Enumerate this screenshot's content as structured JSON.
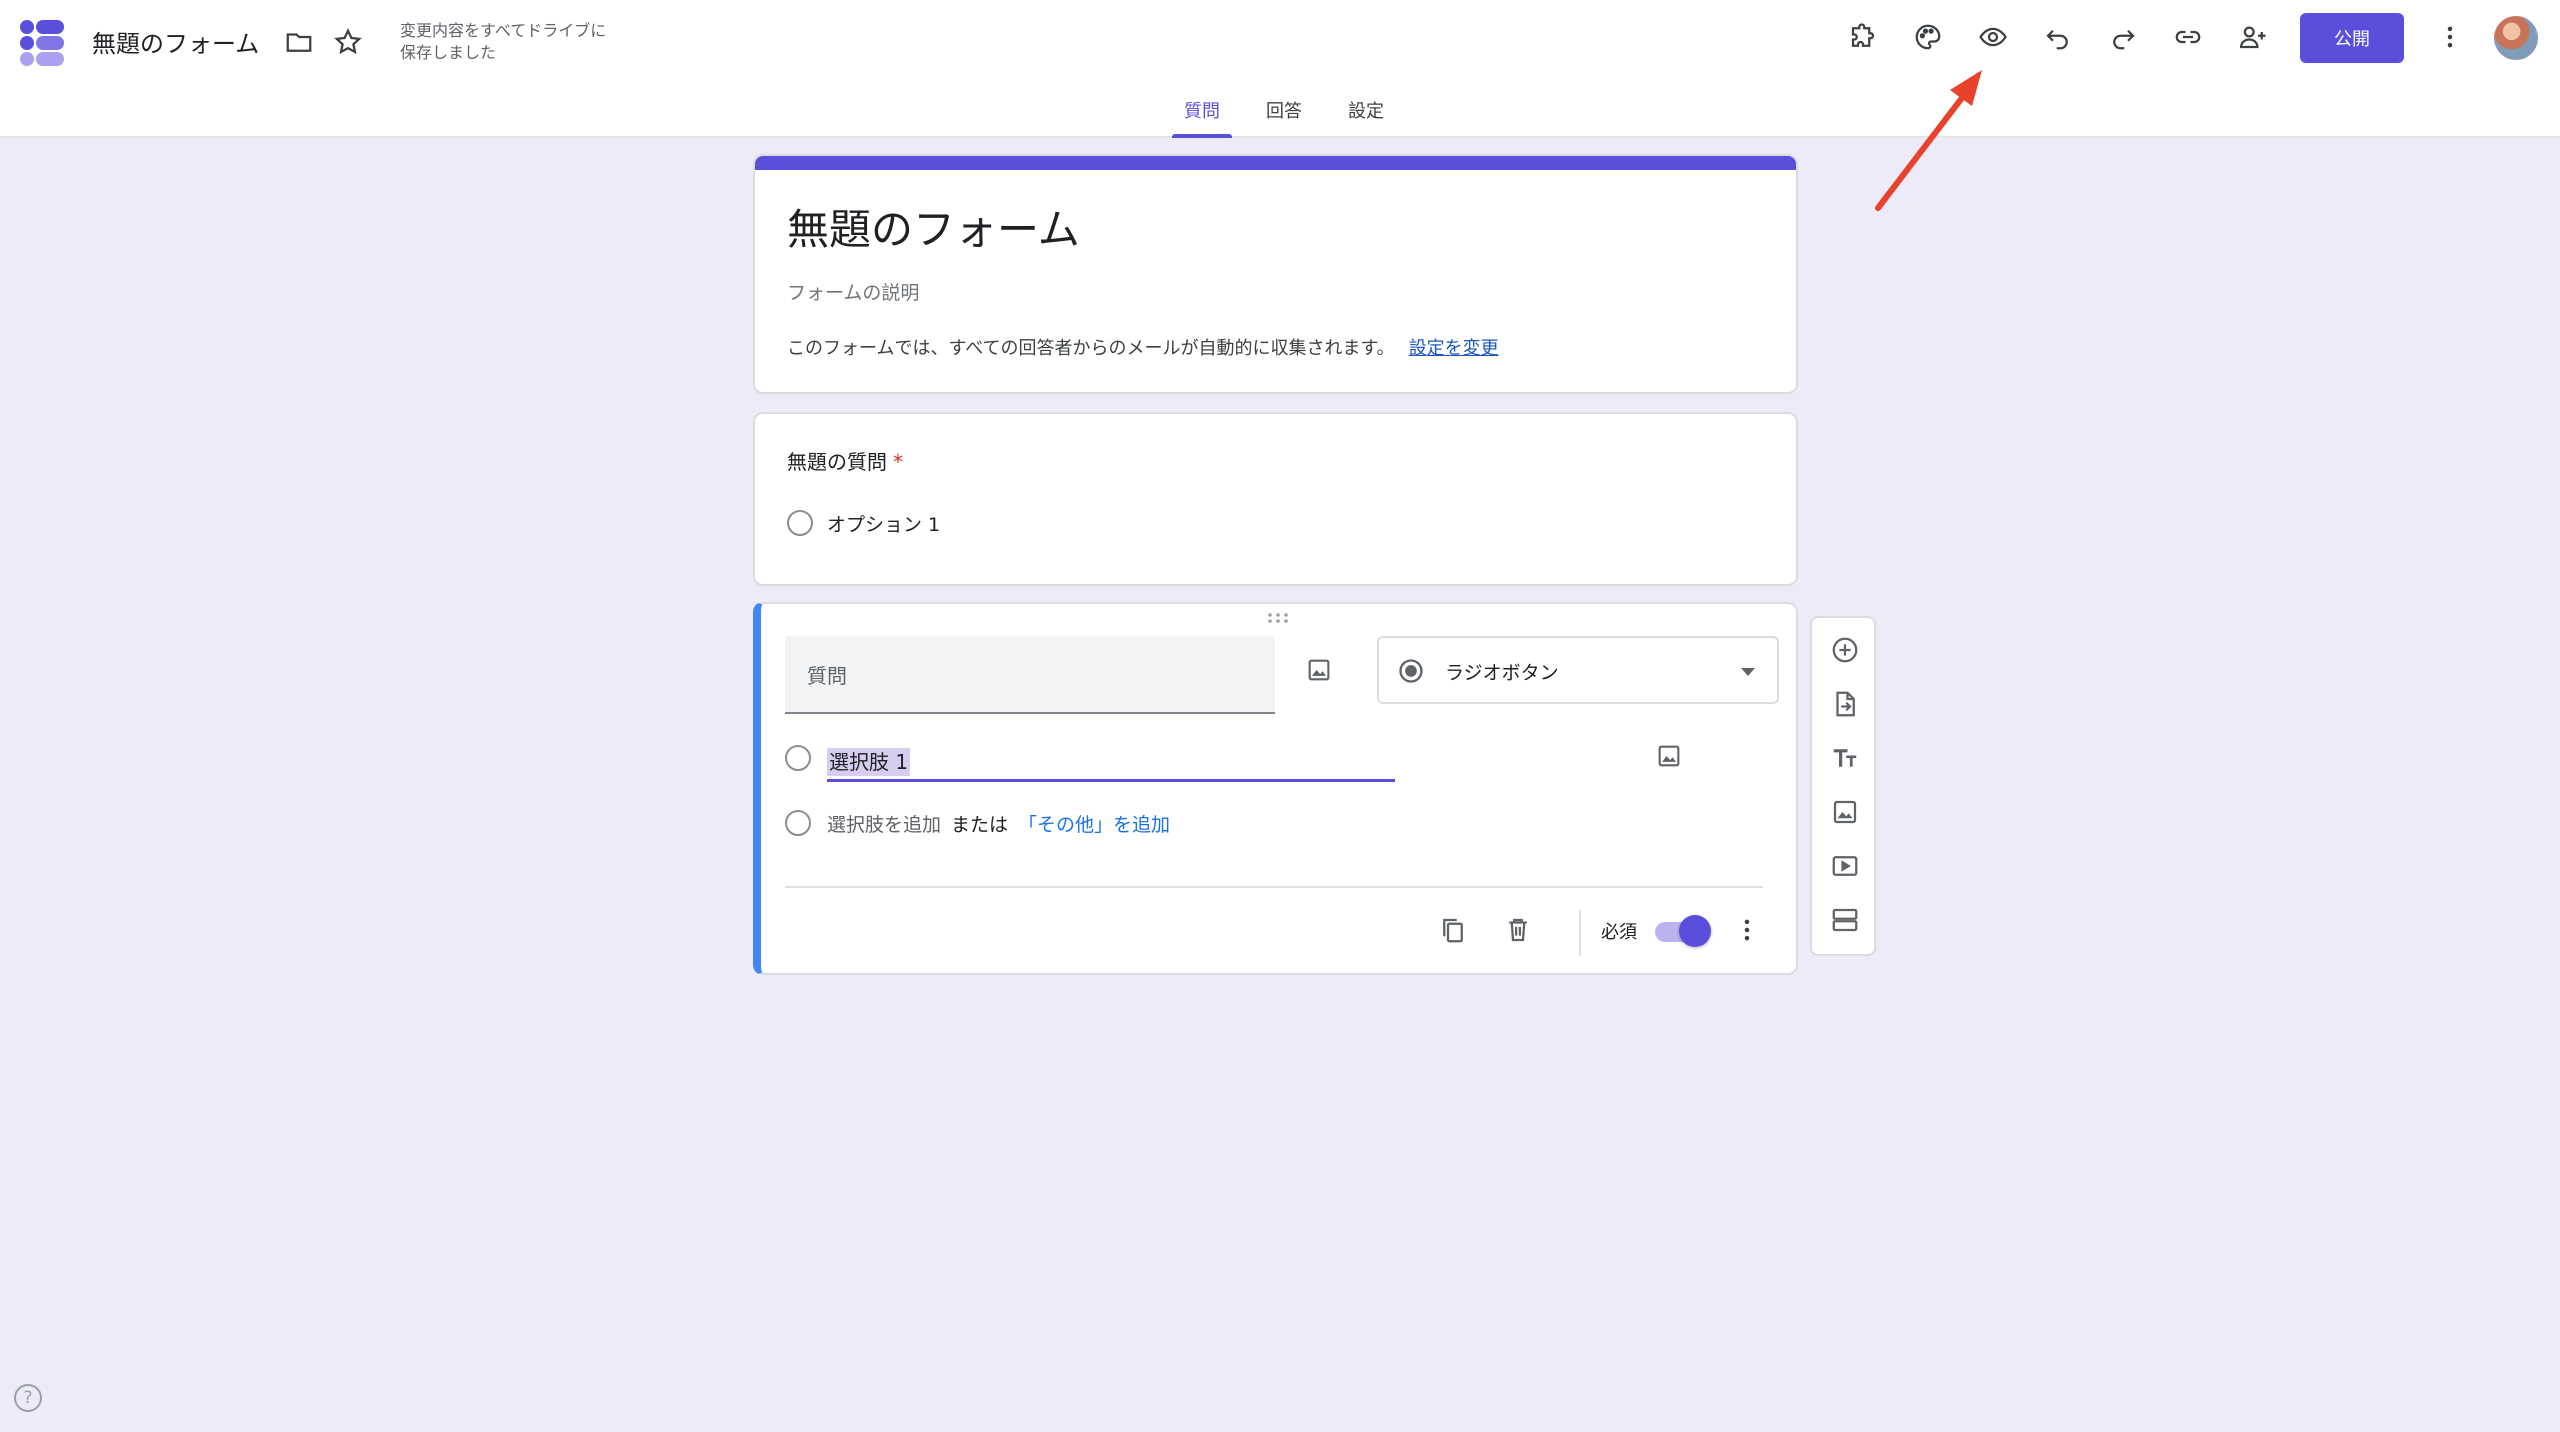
{
  "app": {
    "doc_title": "無題のフォーム",
    "save_status": "変更内容をすべてドライブに\n保存しました",
    "publish_label": "公開"
  },
  "tabs": [
    {
      "label": "質問",
      "active": true
    },
    {
      "label": "回答",
      "active": false
    },
    {
      "label": "設定",
      "active": false
    }
  ],
  "form": {
    "title": "無題のフォーム",
    "description_placeholder": "フォームの説明",
    "email_note": "このフォームでは、すべての回答者からのメールが自動的に収集されます。",
    "change_settings_link": "設定を変更"
  },
  "question1": {
    "title": "無題の質問",
    "required_mark": "*",
    "option1": "オプション 1"
  },
  "question2": {
    "title_placeholder": "質問",
    "type": "ラジオボタン",
    "option1": "選択肢 1",
    "add_option": "選択肢を追加",
    "or_text": "または",
    "add_other": "「その他」を追加",
    "required_label": "必須",
    "required_on": true
  },
  "help_label": "?",
  "colors": {
    "accent": "#5a4fdc",
    "background": "#edebf7",
    "active_card_border": "#4285f4",
    "annotation_arrow": "#e8412c"
  }
}
